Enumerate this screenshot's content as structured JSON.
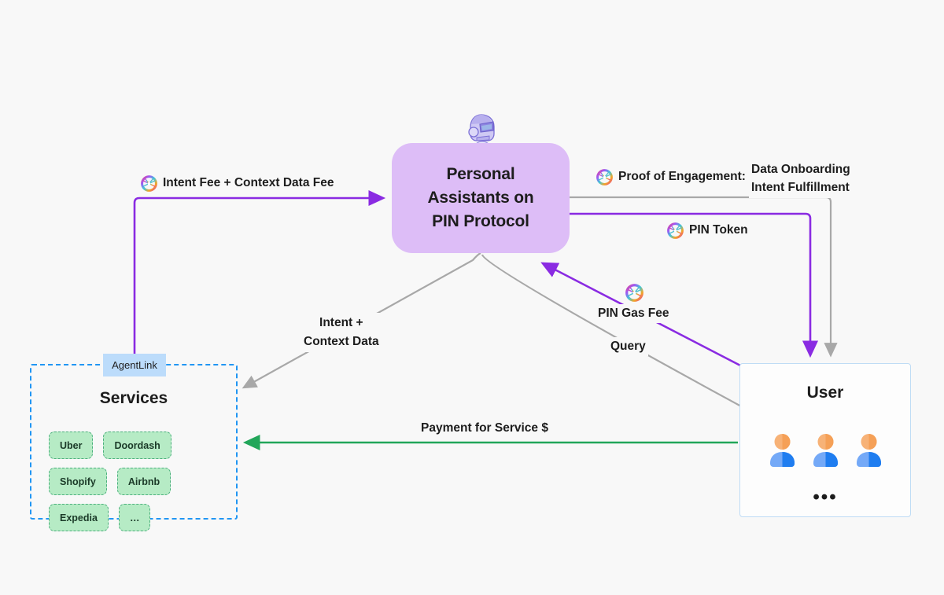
{
  "diagram": {
    "background": "#f8f8f8",
    "accent_purple": "#8a2be2",
    "accent_green": "#22a65a",
    "accent_gray": "#a8a8a8",
    "node_purple_fill": "#ddbdf7",
    "services_border": "#2196f3",
    "chip_fill": "#b6ebc5",
    "chip_border": "#4caf7d",
    "agentlink_fill": "#bcdcfb",
    "user_border": "#bfdcf5"
  },
  "pin_node": {
    "title_line1": "Personal",
    "title_line2": "Assistants on",
    "title_line3": "PIN Protocol",
    "icon": "robot-head-icon"
  },
  "services": {
    "tab_label": "AgentLink",
    "title": "Services",
    "chips": [
      "Uber",
      "Doordash",
      "Shopify",
      "Airbnb",
      "Expedia",
      "…"
    ]
  },
  "user": {
    "title": "User",
    "people_count": 3,
    "more_indicator": "•••"
  },
  "edges": [
    {
      "id": "intent-fee",
      "label": "Intent Fee + Context Data Fee",
      "icon": "pin-token-icon",
      "color": "#8a2be2",
      "from": "AgentLink",
      "to": "Personal Assistants on PIN Protocol"
    },
    {
      "id": "proof-of-engagement",
      "label": "Proof of Engagement:",
      "icon": "pin-token-icon",
      "detail_line1": "Data Onboarding",
      "detail_line2": "Intent Fulfillment",
      "color": "#a8a8a8",
      "from": "Personal Assistants on PIN Protocol",
      "to": "User"
    },
    {
      "id": "pin-token",
      "label": "PIN Token",
      "icon": "pin-token-icon",
      "color": "#8a2be2",
      "from": "Personal Assistants on PIN Protocol",
      "to": "User"
    },
    {
      "id": "intent-context-data",
      "label_line1": "Intent +",
      "label_line2": "Context Data",
      "color": "#a8a8a8",
      "from": "Personal Assistants on PIN Protocol",
      "to": "Services"
    },
    {
      "id": "pin-gas-fee",
      "label": "PIN Gas Fee",
      "icon": "pin-token-icon",
      "color": "#8a2be2",
      "from": "User",
      "to": "Personal Assistants on PIN Protocol"
    },
    {
      "id": "query",
      "label": "Query",
      "color": "#a8a8a8",
      "from": "User",
      "to": "Services"
    },
    {
      "id": "payment-for-service",
      "label": "Payment for Service $",
      "color": "#22a65a",
      "from": "User",
      "to": "Services"
    }
  ]
}
